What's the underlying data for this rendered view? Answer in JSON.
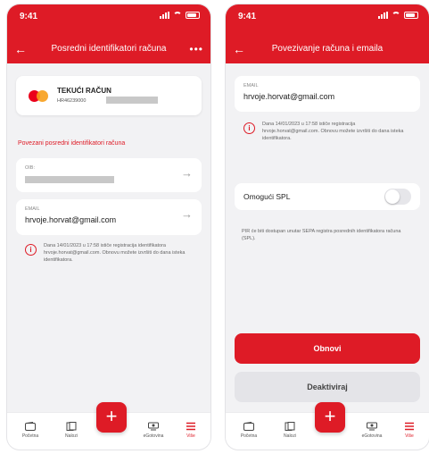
{
  "colors": {
    "brand_red": "#de1b26",
    "background": "#f2f2f4"
  },
  "left": {
    "status": {
      "time": "9:41"
    },
    "header": {
      "title": "Posredni identifikatori računa",
      "back_icon": "arrow-left-icon",
      "more_label": "•••"
    },
    "account": {
      "name": "TEKUĆI RAČUN",
      "iban_prefix": "HR46239000",
      "logo_icon": "mastercard-logo"
    },
    "section_title": "Povezani posredni identifikatori računa",
    "oib": {
      "label": "OIB:",
      "value_masked": true
    },
    "email": {
      "label": "EMAIL",
      "value": "hrvoje.horvat@gmail.com"
    },
    "info": "Dana 14/01/2023 u 17:58 ističe registracija identifikatora hrvoje.horvat@gmail.com. Obnovu možete izvršiti do dana isteka identifikatora."
  },
  "right": {
    "status": {
      "time": "9:41"
    },
    "header": {
      "title": "Povezivanje računa i emaila",
      "back_icon": "arrow-left-icon"
    },
    "email": {
      "label": "EMAIL",
      "value": "hrvoje.horvat@gmail.com"
    },
    "info": "Dana 14/01/2023 u 17:58 ističe registracija hrvoje.horvat@gmail.com. Obnovu možete izvršiti do dana isteka identifikatora.",
    "spl": {
      "label": "Omogući SPL",
      "enabled": false
    },
    "spl_note": "PIR će biti dostupan unutar SEPA registra posrednih identifikatora računa (SPL).",
    "buttons": {
      "renew": "Obnovi",
      "deactivate": "Deaktiviraj"
    }
  },
  "tabbar": {
    "items": [
      {
        "label": "Početna",
        "icon": "wallet-icon"
      },
      {
        "label": "Nalozi",
        "icon": "documents-icon"
      },
      {
        "label": "eGotovina",
        "icon": "cash-icon"
      },
      {
        "label": "Više",
        "icon": "menu-icon"
      }
    ],
    "fab_label": "+",
    "active_index": 3
  }
}
